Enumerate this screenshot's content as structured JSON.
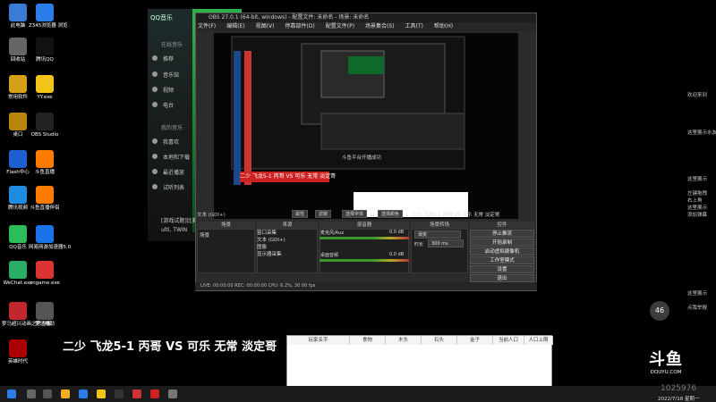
{
  "desktop_icons": [
    {
      "label": "此电脑",
      "color": "#3a7bd5"
    },
    {
      "label": "Z345浏览器\n浏览",
      "color": "#2b7de9"
    },
    {
      "label": "回收站",
      "color": "#666"
    },
    {
      "label": "腾讯QQ",
      "color": "#111"
    },
    {
      "label": "常用软件",
      "color": "#d4a017"
    },
    {
      "label": "YY.exe",
      "color": "#f0c419"
    },
    {
      "label": "桌口",
      "color": "#b8860b"
    },
    {
      "label": "OBS Studio",
      "color": "#222"
    },
    {
      "label": "Flash中心",
      "color": "#1d5fd1"
    },
    {
      "label": "斗鱼直播",
      "color": "#ff7a00"
    },
    {
      "label": "腾讯视频",
      "color": "#1d8be0"
    },
    {
      "label": "斗鱼直播伴侣",
      "color": "#ff7a00"
    },
    {
      "label": "QQ音乐",
      "color": "#2bbd5a"
    },
    {
      "label": "网易网游加速器5.0",
      "color": "#1a73e8"
    },
    {
      "label": "WeChat.exe",
      "color": "#2aae67"
    },
    {
      "label": "cngame.exe",
      "color": "#d33"
    },
    {
      "label": "梦马超兴动画之思查看",
      "color": "#c1272d"
    },
    {
      "label": "梦马相助",
      "color": "#555"
    },
    {
      "label": "英雄时代",
      "color": "#a00"
    }
  ],
  "qq_music": {
    "title": "QQ音乐",
    "section": "在线音乐",
    "items": [
      "推荐",
      "音乐馆",
      "视频",
      "电台"
    ],
    "section2": "我的音乐",
    "items2": [
      "我喜欢",
      "本地和下载",
      "最近播放",
      "试听列表"
    ],
    "footer1": "[游戏试题]比赛",
    "footer2": "ulti, TWIN"
  },
  "obs": {
    "title": "OBS 27.0.1 (64-bit, windows) - 配置文件: 未命名 - 场景: 未命名",
    "menu": [
      "文件(F)",
      "编辑(E)",
      "视图(V)",
      "停靠部件(D)",
      "配置文件(P)",
      "场景集合(S)",
      "工具(T)",
      "帮助(H)"
    ],
    "banner": "二少 飞龙5-1 丙哥 VS 可乐 无常 淡定哥",
    "notice": "斗鱼平台开播成功",
    "text_label": "文本 (GDI+)",
    "props_btn": "属性",
    "filter_btn": "滤镜",
    "select_font": "选择字体",
    "select_color": "选择颜色",
    "source_text": "二少 飞龙5-1 丙哥 VS 可乐 无常 淡定哥",
    "panels": {
      "scenes": "场景",
      "sources": "来源",
      "mixer": "混音器",
      "transitions": "场景转场",
      "controls": "控件"
    },
    "scene_item": "场景",
    "sources_list": [
      "窗口采集",
      "文本 (GDI+)",
      "图像",
      "显示器采集"
    ],
    "mixer_tracks": [
      {
        "name": "麦克风/Aux",
        "db": "0.0 dB"
      },
      {
        "name": "桌面音频",
        "db": "0.0 dB"
      }
    ],
    "transition": "渐变",
    "duration_label": "时长",
    "duration": "300 ms",
    "controls": [
      "停止推流",
      "开始录制",
      "启动虚拟摄像机",
      "工作室模式",
      "设置",
      "退出"
    ],
    "status": "LIVE: 00:00:00   REC: 00:00:00   CPU: 6.2%, 30.00 fps"
  },
  "overlay_title": "二少 飞龙5-1 丙哥 VS 可乐 无常 淡定哥",
  "table_headers": [
    "玩家名字",
    "食物",
    "木头",
    "石头",
    "金子",
    "当前人口",
    "人口上限"
  ],
  "right_chat": [
    "欢迎来到",
    "这里展示水友",
    "这里展示",
    "左键拖拽",
    "右上角",
    "这里展示",
    "添加弹幕",
    "这里展示",
    "点我举报"
  ],
  "counter": "46",
  "douyu_logo": "斗鱼",
  "douyu_url": "DOUYU.COM",
  "uid": "1025976",
  "clock": "2022/7/18 星期一"
}
